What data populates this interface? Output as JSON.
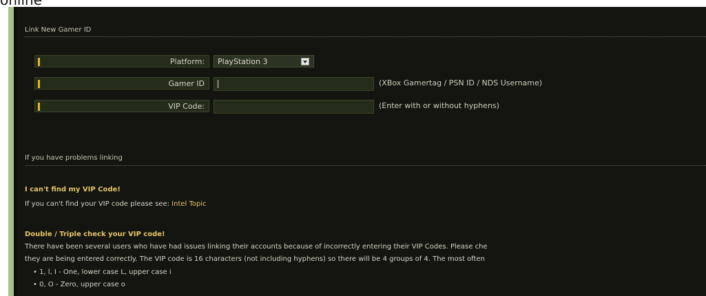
{
  "top_text": "online",
  "link_section": {
    "title": "Link New Gamer ID",
    "fields": [
      {
        "label": "Platform:",
        "type": "select",
        "value": "PlayStation 3"
      },
      {
        "label": "Gamer ID",
        "type": "text",
        "value": "",
        "hint": "(XBox Gamertag / PSN ID / NDS Username)"
      },
      {
        "label": "VIP Code:",
        "type": "text",
        "value": "",
        "hint": "(Enter with or without hyphens)"
      }
    ]
  },
  "help_section": {
    "title": "If you have problems linking",
    "items": [
      {
        "title": "I can't find my VIP Code!",
        "text": "If you can't find your VIP code please see: ",
        "link": "Intel Topic"
      },
      {
        "title": "Double / Triple check your VIP code!",
        "lines": [
          "There have been several users who have had issues linking their accounts because of incorrectly entering their VIP Codes. Please che",
          "they are being entered correctly. The VIP code is 16 characters (not including hyphens) so there will be 4 groups of 4. The most often"
        ],
        "bullets": [
          "• 1, l, I - One, lower case L, upper case i",
          "• 0, O - Zero, upper case o"
        ]
      }
    ]
  },
  "colors": {
    "panel": "#141510",
    "accent_green": "#a4c28a",
    "label_bg": "#252c19",
    "highlight": "#e6c56a",
    "pip": "#e9b423"
  }
}
